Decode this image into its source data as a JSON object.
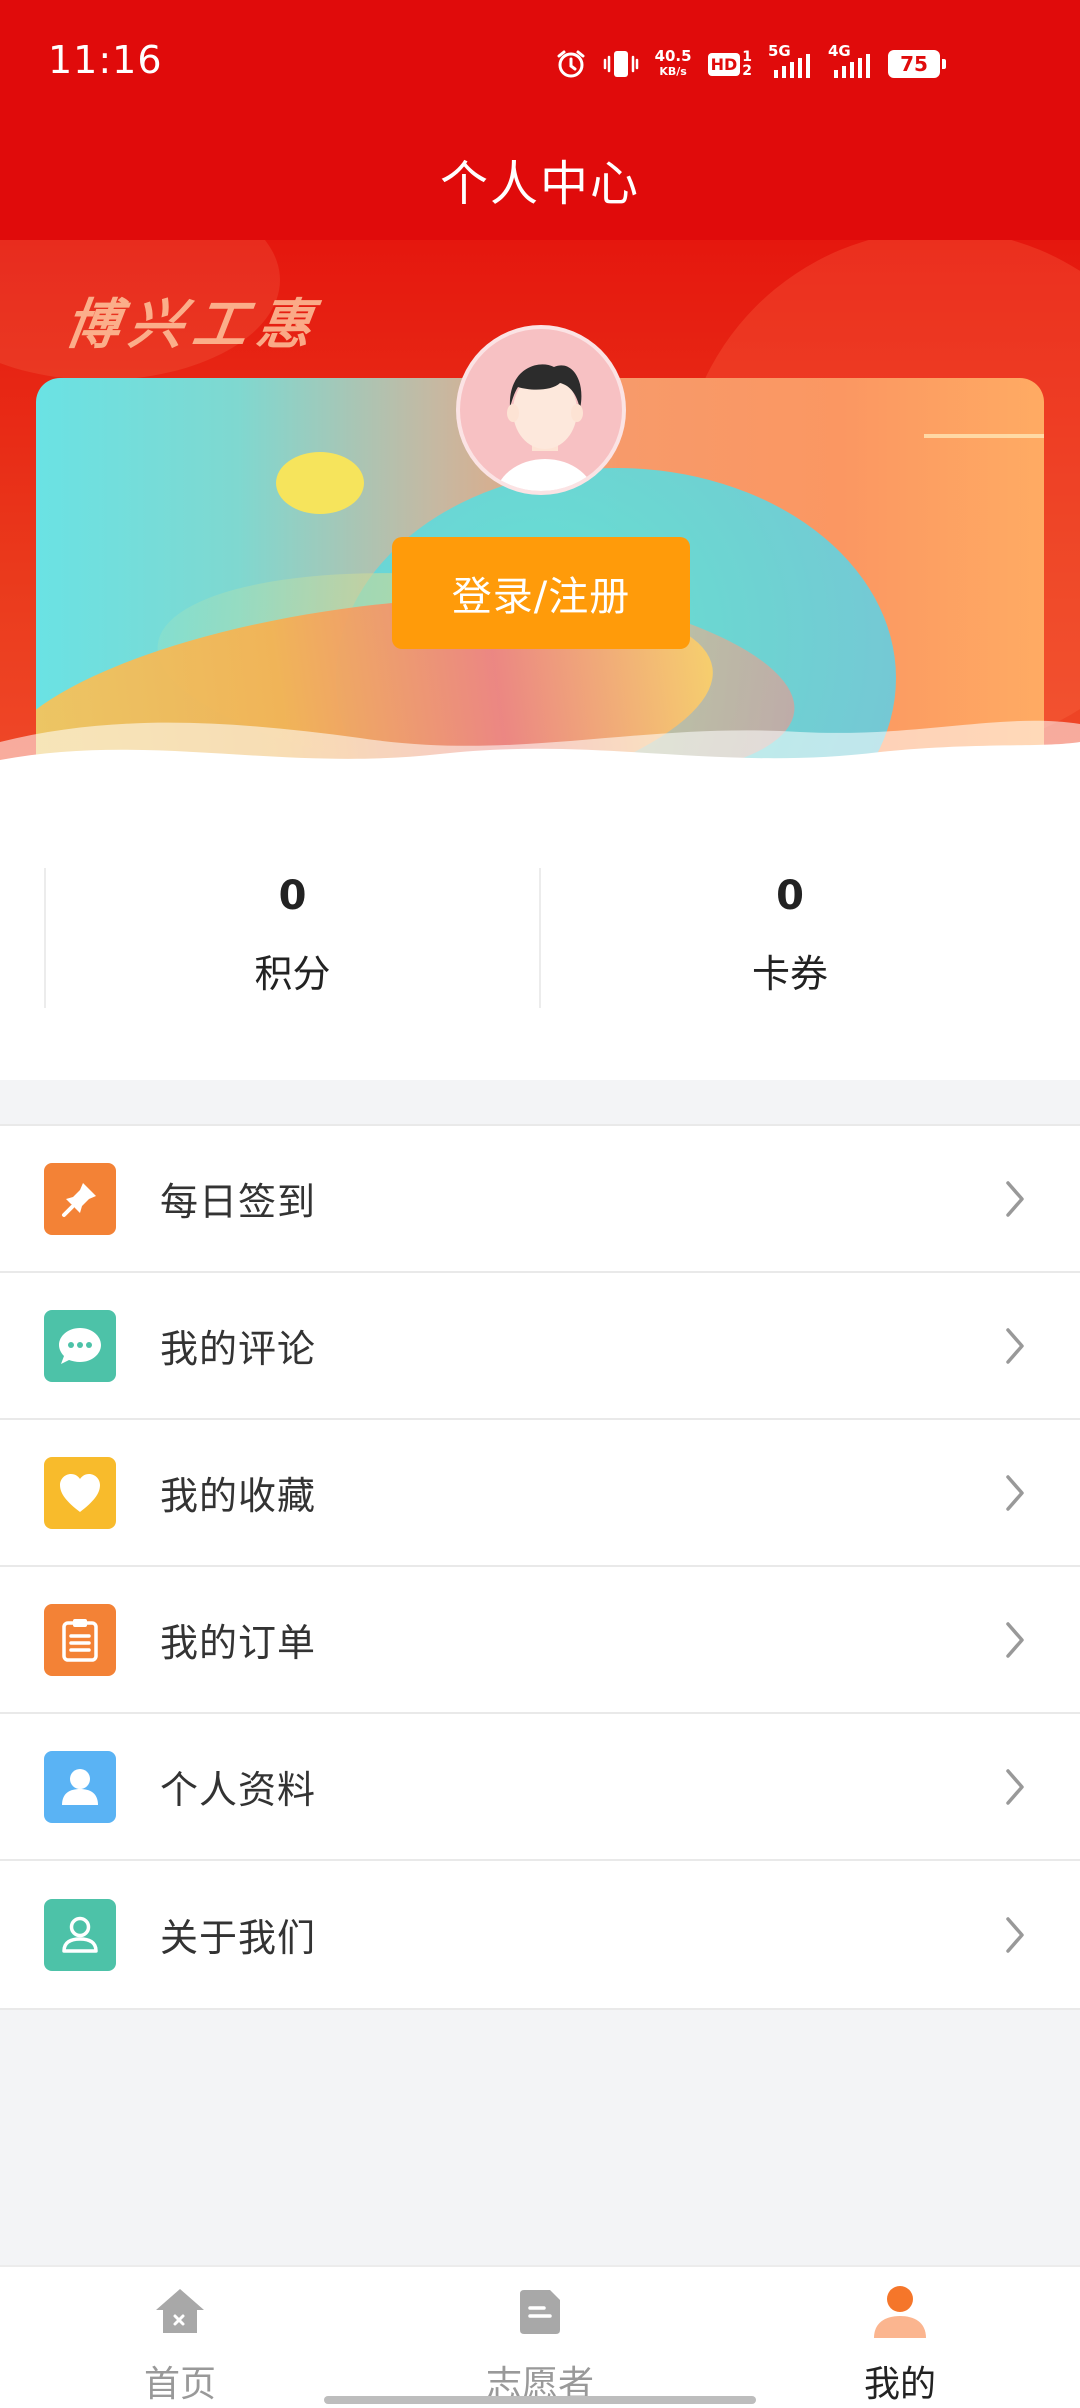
{
  "status_bar": {
    "time": "11:16",
    "speed_value": "40.5",
    "speed_unit": "KB/s",
    "hd_label": "HD",
    "sim_1": "1",
    "sim_2": "2",
    "net_5g": "5G",
    "net_4g": "4G",
    "battery": "75",
    "icons": [
      "alarm-icon",
      "vibrate-icon",
      "hd-icon",
      "signal-5g-icon",
      "signal-4g-icon",
      "battery-icon"
    ]
  },
  "header": {
    "title": "个人中心"
  },
  "banner": {
    "brand_text": "博兴工惠",
    "login_button": "登录/注册"
  },
  "stats": [
    {
      "value": "0",
      "label": "积分"
    },
    {
      "value": "0",
      "label": "卡券"
    }
  ],
  "menu": [
    {
      "label": "每日签到",
      "icon": "pin-icon",
      "color": "#f38236"
    },
    {
      "label": "我的评论",
      "icon": "comment-icon",
      "color": "#4dc2a8"
    },
    {
      "label": "我的收藏",
      "icon": "heart-icon",
      "color": "#f8bb2c"
    },
    {
      "label": "我的订单",
      "icon": "clipboard-icon",
      "color": "#f38236"
    },
    {
      "label": "个人资料",
      "icon": "person-icon",
      "color": "#5ab3f4"
    },
    {
      "label": "关于我们",
      "icon": "contact-icon",
      "color": "#4dc2a8"
    }
  ],
  "bottom_nav": [
    {
      "label": "首页",
      "icon": "home-icon",
      "active": false
    },
    {
      "label": "志愿者",
      "icon": "volunteer-icon",
      "active": false
    },
    {
      "label": "我的",
      "icon": "mine-icon",
      "active": true
    }
  ],
  "colors": {
    "header_red": "#e00b0b",
    "login_orange": "#ff9b0a",
    "active_nav": "#f5762a",
    "inactive_nav": "#a8a8a8"
  }
}
